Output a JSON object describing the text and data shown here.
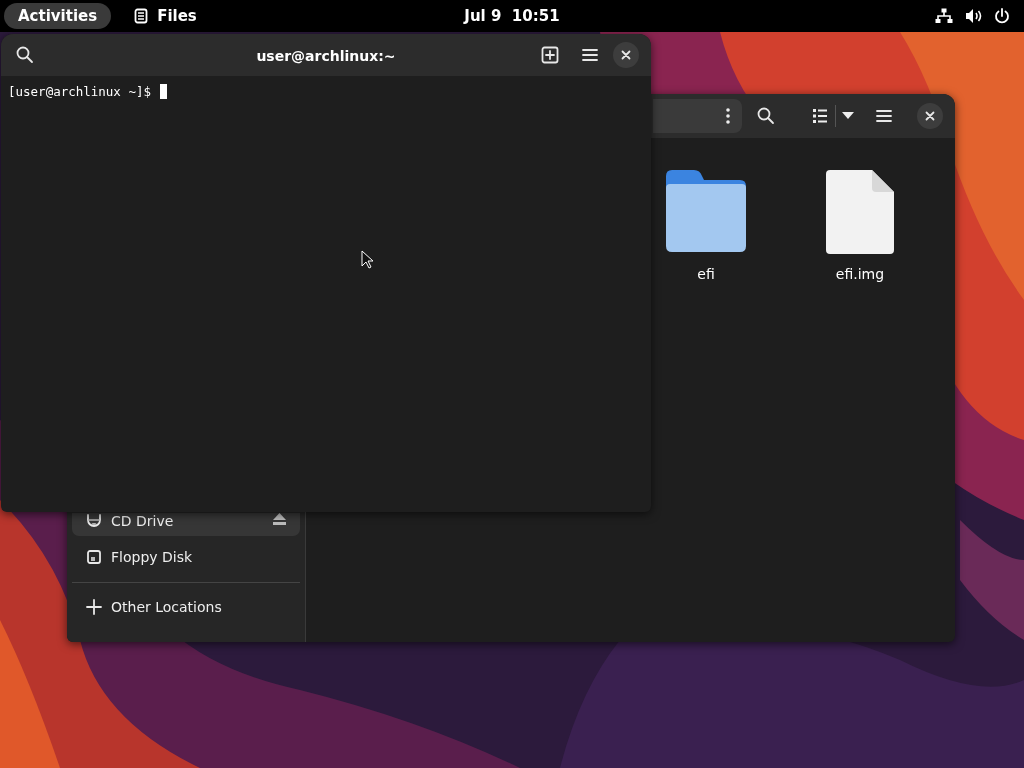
{
  "top_bar": {
    "activities": "Activities",
    "app_name": "Files",
    "clock": "Jul 9  10:51"
  },
  "terminal": {
    "title": "user@archlinux:~",
    "prompt": "[user@archlinux ~]$ "
  },
  "files": {
    "sidebar": [
      {
        "label": "CD Drive",
        "kind": "cd",
        "selected": true,
        "ejectable": true
      },
      {
        "label": "Floppy Disk",
        "kind": "floppy",
        "selected": false,
        "ejectable": false
      },
      {
        "label": "Other Locations",
        "kind": "other",
        "selected": false,
        "ejectable": false
      }
    ],
    "items": [
      {
        "name": "efi",
        "kind": "folder"
      },
      {
        "name": "efi.img",
        "kind": "file"
      }
    ]
  }
}
